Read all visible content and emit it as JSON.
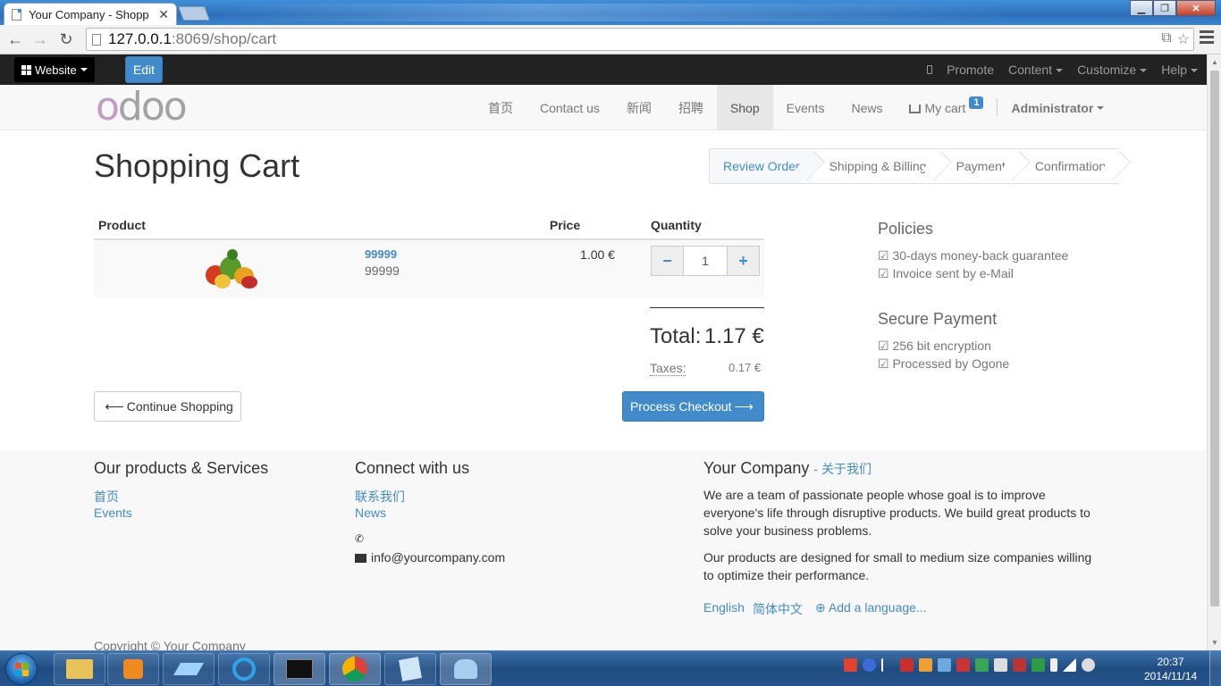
{
  "browser": {
    "tab_title": "Your Company - Shopp",
    "tab_close": "✕",
    "url_host": "127.0.0.1",
    "url_path": ":8069/shop/cart"
  },
  "adminbar": {
    "website_label": "Website",
    "edit_label": "Edit",
    "promote": "Promote",
    "content": "Content",
    "customize": "Customize",
    "help": "Help"
  },
  "nav": {
    "items": [
      "首页",
      "Contact us",
      "新闻",
      "招聘",
      "Shop",
      "Events",
      "News"
    ],
    "cart_label": "My cart",
    "cart_count": "1",
    "admin": "Administrator"
  },
  "page": {
    "title": "Shopping Cart",
    "wizard": [
      "Review Order",
      "Shipping & Billing",
      "Payment",
      "Confirmation"
    ]
  },
  "cart": {
    "headers": {
      "product": "Product",
      "price": "Price",
      "quantity": "Quantity"
    },
    "line": {
      "name": "99999",
      "description": "99999",
      "price": "1.00 €",
      "quantity": "1"
    },
    "minus": "−",
    "plus": "+",
    "total_label": "Total:",
    "total_value": "1.17 €",
    "taxes_label": "Taxes:",
    "taxes_value": "0.17 €",
    "continue_label": "Continue Shopping",
    "checkout_label": "Process Checkout"
  },
  "sidebar": {
    "policies_title": "Policies",
    "policies": [
      "☑ 30-days money-back guarantee",
      "☑ Invoice sent by e-Mail"
    ],
    "payment_title": "Secure Payment",
    "payment": [
      "☑ 256 bit encryption",
      "☑ Processed by Ogone"
    ]
  },
  "footer": {
    "col1_title": "Our products & Services",
    "col1_links": [
      "首页",
      "Events"
    ],
    "col2_title": "Connect with us",
    "col2_links": [
      "联系我们",
      "News"
    ],
    "email": "info@yourcompany.com",
    "col3_title": "Your Company",
    "col3_sub": "- 关于我们",
    "para1_lines": [
      "We are a team of passionate people whose goal is to improve",
      "everyone's life through disruptive products. We build great products to",
      "solve your business problems."
    ],
    "para2_lines": [
      "Our products are designed for small to medium size companies willing",
      "to optimize their performance."
    ],
    "lang_en": "English",
    "lang_zh": "简体中文",
    "add_language": "Add a language...",
    "copyright": "Copyright © Your Company"
  },
  "taskbar": {
    "time": "20:37",
    "date": "2014/11/14"
  },
  "colors": {
    "accent": "#428bca",
    "adminbar": "#222222",
    "logo_o1": "#c49bc2",
    "logo_rest": "#a3a3a3"
  }
}
